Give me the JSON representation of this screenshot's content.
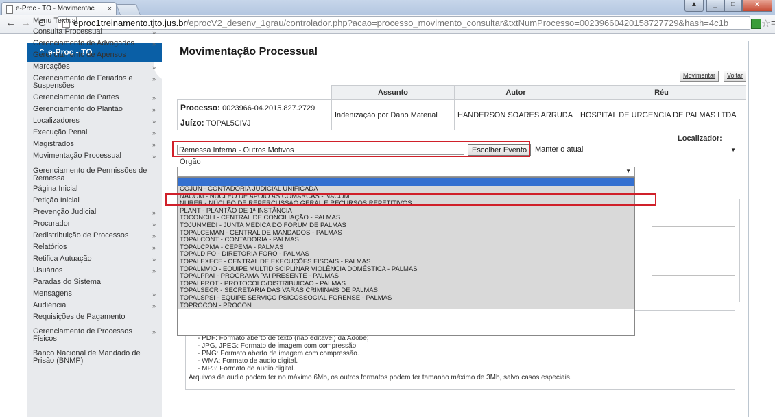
{
  "browser": {
    "tab_title": "e-Proc - TO - Movimentac",
    "tab_close": "×",
    "url_host": "eproc1treinamento.tjto.jus.br",
    "url_path": "/eprocV2_desenv_1grau/controlador.php?acao=processo_movimento_consultar&txtNumProcesso=00239660420158727729&hash=4c1b"
  },
  "sidebar": {
    "title": "e-Proc - TO",
    "items": [
      {
        "label": "Menu Textual",
        "chevron": ""
      },
      {
        "label": "Consulta Processual",
        "chevron": "»"
      },
      {
        "label": "Gerenciamento de Advogados",
        "chevron": "»"
      },
      {
        "label": "Gerenciamento de Apensos",
        "chevron": ""
      },
      {
        "label": "Marcações",
        "chevron": "»"
      },
      {
        "label": "Gerenciamento de Feriados e Suspensões",
        "chevron": "»"
      },
      {
        "label": "Gerenciamento de Partes",
        "chevron": "»"
      },
      {
        "label": "Gerenciamento do Plantão",
        "chevron": "»"
      },
      {
        "label": "Localizadores",
        "chevron": "»"
      },
      {
        "label": "Execução Penal",
        "chevron": "»"
      },
      {
        "label": "Magistrados",
        "chevron": "»"
      },
      {
        "label": "Movimentação Processual",
        "chevron": "»"
      },
      {
        "label": "Gerenciamento de Permissões de Remessa",
        "chevron": ""
      },
      {
        "label": "Página Inicial",
        "chevron": ""
      },
      {
        "label": "Petição Inicial",
        "chevron": ""
      },
      {
        "label": "Prevenção Judicial",
        "chevron": "»"
      },
      {
        "label": "Procurador",
        "chevron": "»"
      },
      {
        "label": "Redistribuição de Processos",
        "chevron": "»"
      },
      {
        "label": "Relatórios",
        "chevron": "»"
      },
      {
        "label": "Retifica Autuação",
        "chevron": "»"
      },
      {
        "label": "Usuários",
        "chevron": "»"
      },
      {
        "label": "Paradas do Sistema",
        "chevron": ""
      },
      {
        "label": "Mensagens",
        "chevron": "»"
      },
      {
        "label": "Audiência",
        "chevron": "»"
      },
      {
        "label": "Requisições de Pagamento",
        "chevron": ""
      },
      {
        "label": "Gerenciamento de Processos Físicos",
        "chevron": "»"
      },
      {
        "label": "Banco Nacional de Mandado de Prisão (BNMP)",
        "chevron": ""
      }
    ]
  },
  "page": {
    "title": "Movimentação Processual",
    "btn_movimentar": "Movimentar",
    "btn_voltar": "Voltar"
  },
  "process_table": {
    "headers": [
      "Assunto",
      "Autor",
      "Réu"
    ],
    "processo_label": "Processo:",
    "processo_value": "0023966-04.2015.827.2729",
    "juizo_label": "Juízo:",
    "juizo_value": "TOPAL5CIVJ",
    "assunto": "Indenização por Dano Material",
    "autor": "HANDERSON SOARES ARRUDA",
    "reu": "HOSPITAL DE URGENCIA DE PALMAS LTDA"
  },
  "form": {
    "evento_value": "Remessa Interna - Outros Motivos",
    "escolher_evento": "Escolher Evento",
    "localizador_label": "Localizador:",
    "localizador_value": "Manter o atual",
    "orgao_label": "Orgão",
    "orgao_options": [
      "COJUN - CONTADORIA JUDICIAL UNIFICADA",
      "NACOM - NÚCLEO DE APOIO AS COMARCAS - NACOM",
      "NURER - NÚCLEO DE REPERCUSSÃO GERAL E RECURSOS REPETITIVOS",
      "PLANT - PLANTÃO DE 1ª INSTÂNCIA",
      "TOCONCILI - CENTRAL DE CONCILIAÇÃO - PALMAS",
      "TOJUNMEDI - JUNTA MÉDICA DO FORUM DE PALMAS",
      "TOPALCEMAN - CENTRAL DE MANDADOS - PALMAS",
      "TOPALCONT - CONTADORIA - PALMAS",
      "TOPALCPMA - CEPEMA - PALMAS",
      "TOPALDIFO - DIRETORIA FORO - PALMAS",
      "TOPALEXECF - CENTRAL DE EXECUÇÕES FISCAIS - PALMAS",
      "TOPALMVIO - EQUIPE MULTIDISCIPLINAR VIOLÊNCIA DOMÉSTICA - PALMAS",
      "TOPALPPAI - PROGRAMA PAI PRESENTE - PALMAS",
      "TOPALPROT - PROTOCOLO/DISTRIBUICAO - PALMAS",
      "TOPALSECR - SECRETARIA DAS VARAS CRIMINAIS DE PALMAS",
      "TOPALSPSI - EQUIPE SERVIÇO PSICOSSOCIAL FORENSE - PALMAS",
      "TOPROCON - PROCON"
    ]
  },
  "file_info": {
    "lines": [
      "- PDF: Formato aberto de texto (não editável) da Adobe;",
      "- JPG, JPEG: Formato de imagem com compressão;",
      "- PNG: Formato aberto de imagem com compressão.",
      "- WMA: Formato de audio digital.",
      "- MP3: Formato de audio digital."
    ],
    "footer": "Arquivos de audio podem ter no máximo 6Mb, os outros formatos podem ter tamanho máximo de 3Mb, salvo casos especiais."
  }
}
